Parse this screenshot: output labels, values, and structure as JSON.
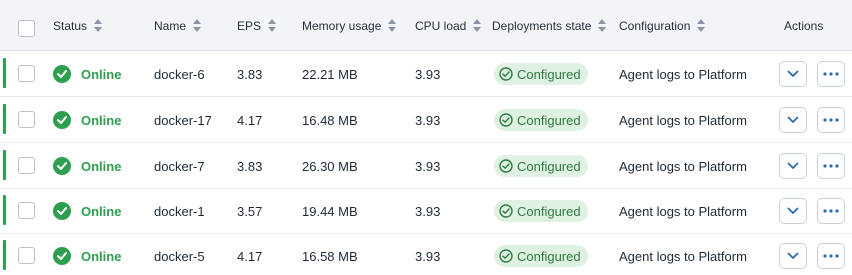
{
  "table": {
    "headers": {
      "status": "Status",
      "name": "Name",
      "eps": "EPS",
      "memory": "Memory usage",
      "cpu": "CPU load",
      "deployments": "Deployments state",
      "configuration": "Configuration",
      "actions": "Actions"
    },
    "rows": [
      {
        "status": "Online",
        "name": "docker-6",
        "eps": "3.83",
        "memory": "22.21 MB",
        "cpu": "3.93",
        "deployment": "Configured",
        "configuration": "Agent logs to Platform"
      },
      {
        "status": "Online",
        "name": "docker-17",
        "eps": "4.17",
        "memory": "16.48 MB",
        "cpu": "3.93",
        "deployment": "Configured",
        "configuration": "Agent logs to Platform"
      },
      {
        "status": "Online",
        "name": "docker-7",
        "eps": "3.83",
        "memory": "26.30 MB",
        "cpu": "3.93",
        "deployment": "Configured",
        "configuration": "Agent logs to Platform"
      },
      {
        "status": "Online",
        "name": "docker-1",
        "eps": "3.57",
        "memory": "19.44 MB",
        "cpu": "3.93",
        "deployment": "Configured",
        "configuration": "Agent logs to Platform"
      },
      {
        "status": "Online",
        "name": "docker-5",
        "eps": "4.17",
        "memory": "16.58 MB",
        "cpu": "3.93",
        "deployment": "Configured",
        "configuration": "Agent logs to Platform"
      }
    ]
  },
  "icons": {
    "status_online": "check-circle-icon",
    "deployment_configured": "check-circle-outline-icon",
    "expand": "chevron-down-icon",
    "more": "more-horizontal-icon",
    "sort": "sort-icon"
  },
  "colors": {
    "online": "#2e9e4f",
    "badge_bg": "#dff1e2",
    "badge_text": "#2e7d3f",
    "header_bg": "#f2f4f8",
    "action_icon": "#2b6cb0"
  }
}
